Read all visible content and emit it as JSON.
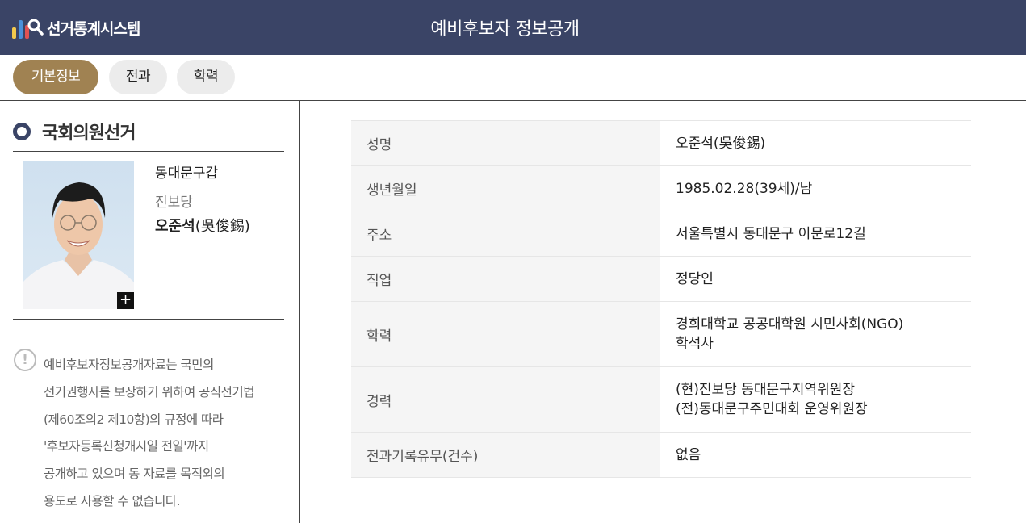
{
  "header": {
    "app_name": "선거통계시스템",
    "page_title": "예비후보자 정보공개"
  },
  "tabs": [
    {
      "label": "기본정보",
      "active": true
    },
    {
      "label": "전과",
      "active": false
    },
    {
      "label": "학력",
      "active": false
    }
  ],
  "candidate": {
    "election": "국회의원선거",
    "district": "동대문구갑",
    "party": "진보당",
    "name": "오준석",
    "name_hanja": "(吳俊錫)",
    "zoom_symbol": "+"
  },
  "notice": {
    "icon": "!",
    "lines": [
      "예비후보자정보공개자료는 국민의",
      "선거권행사를 보장하기 위하여 공직선거법",
      "(제60조의2 제10항)의 규정에 따라",
      "'후보자등록신청개시일 전일'까지",
      "공개하고 있으며 동 자료를 목적외의",
      "용도로 사용할 수 없습니다."
    ]
  },
  "info": [
    {
      "label": "성명",
      "value": [
        "오준석(吳俊錫)"
      ]
    },
    {
      "label": "생년월일",
      "value": [
        "1985.02.28(39세)/남"
      ]
    },
    {
      "label": "주소",
      "value": [
        "서울특별시 동대문구 이문로12길"
      ]
    },
    {
      "label": "직업",
      "value": [
        "정당인"
      ]
    },
    {
      "label": "학력",
      "value": [
        "경희대학교 공공대학원 시민사회(NGO)",
        "학석사"
      ]
    },
    {
      "label": "경력",
      "value": [
        "(현)진보당 동대문구지역위원장",
        "(전)동대문구주민대회 운영위원장"
      ]
    },
    {
      "label": "전과기록유무(건수)",
      "value": [
        "없음"
      ]
    }
  ],
  "colors": {
    "header_bg": "#3a4466",
    "active_tab": "#a08252",
    "tab_bg": "#ececec",
    "label_bg": "#f5f5f5"
  }
}
